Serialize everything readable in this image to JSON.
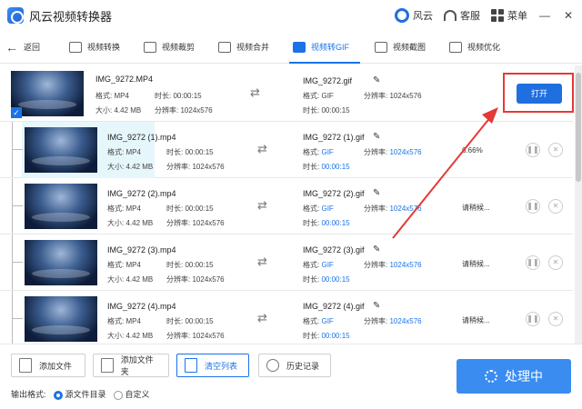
{
  "app": {
    "title": "风云视频转换器"
  },
  "titlebar": {
    "brand": "风云",
    "service": "客服",
    "menu": "菜单",
    "minimize": "—",
    "close": "✕"
  },
  "nav": {
    "back": "返回",
    "tabs": [
      "视频转换",
      "视频裁剪",
      "视频合并",
      "视频转GIF",
      "视频截图",
      "视频优化"
    ],
    "active_tab": "视频转GIF"
  },
  "labels": {
    "format": "格式:",
    "duration": "时长:",
    "size": "大小:",
    "resolution": "分辨率:"
  },
  "first_row": {
    "source_name": "IMG_9272.MP4",
    "format": "MP4",
    "duration": "00:00:15",
    "size": "4.42 MB",
    "resolution": "1024x576",
    "out_name": "IMG_9272.gif",
    "out_format": "GIF",
    "out_duration": "00:00:15",
    "out_resolution": "1024x576",
    "open_button": "打开"
  },
  "rows": [
    {
      "source_name": "IMG_9272 (1).mp4",
      "format": "MP4",
      "duration": "00:00:15",
      "size": "4.42 MB",
      "resolution": "1024x576",
      "out_name": "IMG_9272 (1).gif",
      "out_format": "GIF",
      "out_duration": "00:00:15",
      "out_resolution": "1024x576",
      "status": "6.66%"
    },
    {
      "source_name": "IMG_9272 (2).mp4",
      "format": "MP4",
      "duration": "00:00:15",
      "size": "4.42 MB",
      "resolution": "1024x576",
      "out_name": "IMG_9272 (2).gif",
      "out_format": "GIF",
      "out_duration": "00:00:15",
      "out_resolution": "1024x576",
      "status": "请稍候..."
    },
    {
      "source_name": "IMG_9272 (3).mp4",
      "format": "MP4",
      "duration": "00:00:15",
      "size": "4.42 MB",
      "resolution": "1024x576",
      "out_name": "IMG_9272 (3).gif",
      "out_format": "GIF",
      "out_duration": "00:00:15",
      "out_resolution": "1024x576",
      "status": "请稍候..."
    },
    {
      "source_name": "IMG_9272 (4).mp4",
      "format": "MP4",
      "duration": "00:00:15",
      "size": "4.42 MB",
      "resolution": "1024x576",
      "out_name": "IMG_9272 (4).gif",
      "out_format": "GIF",
      "out_duration": "00:00:15",
      "out_resolution": "1024x576",
      "status": "请稍候..."
    }
  ],
  "bottom": {
    "add_file": "添加文件",
    "add_folder": "添加文件夹",
    "clear_list": "清空列表",
    "history": "历史记录",
    "output_format_label": "输出格式:",
    "option_source_dir": "源文件目录",
    "option_custom": "自定义",
    "process_button": "处理中"
  },
  "colors": {
    "accent": "#1a73e8",
    "highlight": "#e53935"
  }
}
